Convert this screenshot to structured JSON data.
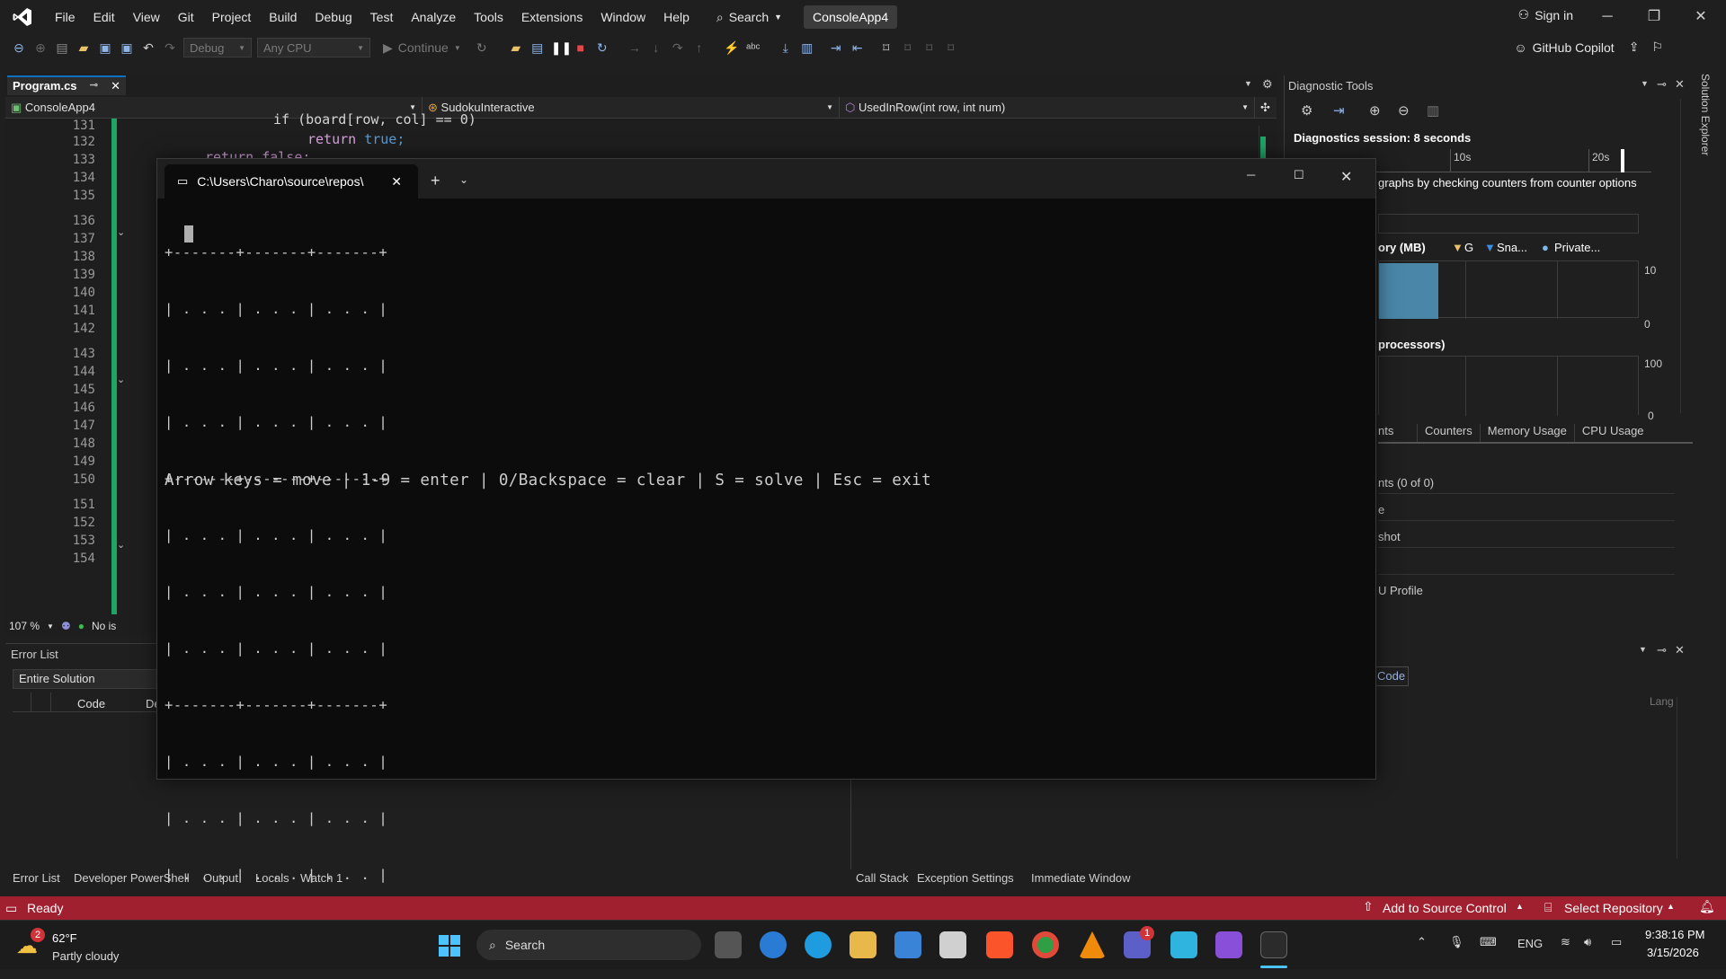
{
  "titlebar": {
    "menu": [
      "File",
      "Edit",
      "View",
      "Git",
      "Project",
      "Build",
      "Debug",
      "Test",
      "Analyze",
      "Tools",
      "Extensions",
      "Window",
      "Help"
    ],
    "search_label": "Search",
    "app_name": "ConsoleApp4",
    "signin_label": "Sign in"
  },
  "toolbar": {
    "config": "Debug",
    "platform": "Any CPU",
    "continue_label": "Continue",
    "copilot_label": "GitHub Copilot"
  },
  "editor": {
    "tab_label": "Program.cs",
    "nav_project": "ConsoleApp4",
    "nav_class": "SudokuInteractive",
    "nav_member": "UsedInRow(int row, int num)",
    "line_numbers": [
      "131",
      "132",
      "133",
      "134",
      "135",
      "136",
      "137",
      "138",
      "139",
      "140",
      "141",
      "142",
      "143",
      "144",
      "145",
      "146",
      "147",
      "148",
      "149",
      "150",
      "151",
      "152",
      "153",
      "154"
    ],
    "code_line_1": "if (board[row, col] == 0)",
    "code_line_2_kw": "return",
    "code_line_2_val": "true;",
    "code_line_3": "return false;",
    "zoom": "107 %",
    "issues": "No is"
  },
  "console": {
    "tab_title": "C:\\Users\\Charo\\source\\repos\\",
    "grid_lines": [
      "+-------+-------+-------+",
      "| . . . | . . . | . . . |",
      "| . . . | . . . | . . . |",
      "| . . . | . . . | . . . |",
      "+-------+-------+-------+",
      "| . . . | . . . | . . . |",
      "| . . . | . . . | . . . |",
      "| . . . | . . . | . . . |",
      "+-------+-------+-------+",
      "| . . . | . . . | . . . |",
      "| . . . | . . . | . . . |",
      "| . . . | . . . | . . . |",
      "+-------+-------+-------+"
    ],
    "help_text": "Arrow keys = move | 1-9 = enter | 0/Backspace = clear | S = solve | Esc = exit"
  },
  "diagnostics": {
    "title": "Diagnostic Tools",
    "session": "Diagnostics session: 8 seconds",
    "t10": "10s",
    "t20": "20s",
    "hint": "graphs by checking counters from counter options",
    "memory_label": "ory (MB)",
    "legend_g": "G",
    "legend_sna": "Sna...",
    "legend_private": "Private...",
    "mem_max": "10",
    "mem_min": "0",
    "cpu_label": "processors)",
    "cpu_max": "100",
    "cpu_min": "0",
    "tabs": [
      "nts",
      "Counters",
      "Memory Usage",
      "CPU Usage"
    ],
    "events": "nts (0 of 0)",
    "row2": "e",
    "snapshot": "shot",
    "cpu_profile": "U Profile"
  },
  "error_list": {
    "title": "Error List",
    "scope": "Entire Solution",
    "col_code": "Code",
    "col_desc": "De"
  },
  "bottom_right": {
    "code_btn": "Code",
    "lang": "Lang"
  },
  "bottom_tabs_left": [
    "Error List",
    "Developer PowerShell",
    "Output",
    "Locals",
    "Watch 1"
  ],
  "bottom_tabs_right": [
    "Call Stack",
    "Exception Settings",
    "Immediate Window"
  ],
  "statusbar": {
    "ready": "Ready",
    "source_control": "Add to Source Control",
    "repo": "Select Repository"
  },
  "taskbar": {
    "weather_temp": "62°F",
    "weather_desc": "Partly cloudy",
    "weather_badge": "2",
    "search_label": "Search",
    "lang": "ENG",
    "time": "9:38:16 PM",
    "date": "3/15/2026",
    "teams_badge": "1"
  },
  "colors": {
    "statusbar": "#a1202f",
    "accent": "#0e70c0",
    "change_bar": "#21a366"
  }
}
